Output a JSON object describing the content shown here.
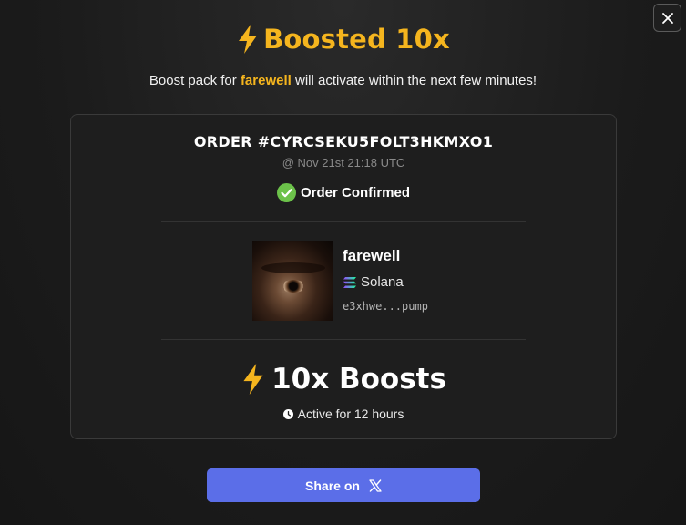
{
  "header": {
    "title": "Boosted 10x",
    "subtitle_prefix": "Boost pack for ",
    "subtitle_token": "farewell",
    "subtitle_suffix": " will activate within the next few minutes!"
  },
  "order": {
    "id_text": "ORDER #CYRCSEKU5FOLT3HKMXO1",
    "time_text": "@ Nov 21st 21:18 UTC",
    "status_text": "Order Confirmed"
  },
  "token": {
    "name": "farewell",
    "chain": "Solana",
    "address": "e3xhwe...pump"
  },
  "boost": {
    "label": "10x Boosts",
    "duration_text": "Active for 12 hours"
  },
  "actions": {
    "share_label": "Share on"
  },
  "colors": {
    "accent": "#f5b51e",
    "confirm_green": "#6cc24a",
    "button": "#5b6ee8"
  },
  "icons": {
    "close": "close-icon",
    "title": "lightning-bolt-icon",
    "status": "check-circle-icon",
    "chain": "solana-icon",
    "boost": "lightning-bolt-icon",
    "duration": "clock-icon",
    "share": "x-logo-icon"
  }
}
